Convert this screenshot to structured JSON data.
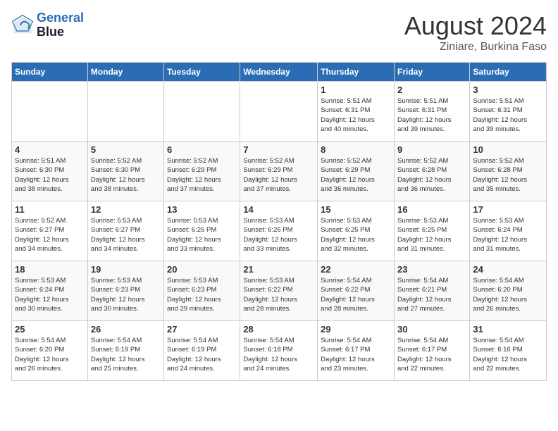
{
  "header": {
    "logo_line1": "General",
    "logo_line2": "Blue",
    "title": "August 2024",
    "subtitle": "Ziniare, Burkina Faso"
  },
  "weekdays": [
    "Sunday",
    "Monday",
    "Tuesday",
    "Wednesday",
    "Thursday",
    "Friday",
    "Saturday"
  ],
  "weeks": [
    [
      {
        "day": "",
        "info": ""
      },
      {
        "day": "",
        "info": ""
      },
      {
        "day": "",
        "info": ""
      },
      {
        "day": "",
        "info": ""
      },
      {
        "day": "1",
        "info": "Sunrise: 5:51 AM\nSunset: 6:31 PM\nDaylight: 12 hours\nand 40 minutes."
      },
      {
        "day": "2",
        "info": "Sunrise: 5:51 AM\nSunset: 6:31 PM\nDaylight: 12 hours\nand 39 minutes."
      },
      {
        "day": "3",
        "info": "Sunrise: 5:51 AM\nSunset: 6:31 PM\nDaylight: 12 hours\nand 39 minutes."
      }
    ],
    [
      {
        "day": "4",
        "info": "Sunrise: 5:51 AM\nSunset: 6:30 PM\nDaylight: 12 hours\nand 38 minutes."
      },
      {
        "day": "5",
        "info": "Sunrise: 5:52 AM\nSunset: 6:30 PM\nDaylight: 12 hours\nand 38 minutes."
      },
      {
        "day": "6",
        "info": "Sunrise: 5:52 AM\nSunset: 6:29 PM\nDaylight: 12 hours\nand 37 minutes."
      },
      {
        "day": "7",
        "info": "Sunrise: 5:52 AM\nSunset: 6:29 PM\nDaylight: 12 hours\nand 37 minutes."
      },
      {
        "day": "8",
        "info": "Sunrise: 5:52 AM\nSunset: 6:29 PM\nDaylight: 12 hours\nand 36 minutes."
      },
      {
        "day": "9",
        "info": "Sunrise: 5:52 AM\nSunset: 6:28 PM\nDaylight: 12 hours\nand 36 minutes."
      },
      {
        "day": "10",
        "info": "Sunrise: 5:52 AM\nSunset: 6:28 PM\nDaylight: 12 hours\nand 35 minutes."
      }
    ],
    [
      {
        "day": "11",
        "info": "Sunrise: 5:52 AM\nSunset: 6:27 PM\nDaylight: 12 hours\nand 34 minutes."
      },
      {
        "day": "12",
        "info": "Sunrise: 5:53 AM\nSunset: 6:27 PM\nDaylight: 12 hours\nand 34 minutes."
      },
      {
        "day": "13",
        "info": "Sunrise: 5:53 AM\nSunset: 6:26 PM\nDaylight: 12 hours\nand 33 minutes."
      },
      {
        "day": "14",
        "info": "Sunrise: 5:53 AM\nSunset: 6:26 PM\nDaylight: 12 hours\nand 33 minutes."
      },
      {
        "day": "15",
        "info": "Sunrise: 5:53 AM\nSunset: 6:25 PM\nDaylight: 12 hours\nand 32 minutes."
      },
      {
        "day": "16",
        "info": "Sunrise: 5:53 AM\nSunset: 6:25 PM\nDaylight: 12 hours\nand 31 minutes."
      },
      {
        "day": "17",
        "info": "Sunrise: 5:53 AM\nSunset: 6:24 PM\nDaylight: 12 hours\nand 31 minutes."
      }
    ],
    [
      {
        "day": "18",
        "info": "Sunrise: 5:53 AM\nSunset: 6:24 PM\nDaylight: 12 hours\nand 30 minutes."
      },
      {
        "day": "19",
        "info": "Sunrise: 5:53 AM\nSunset: 6:23 PM\nDaylight: 12 hours\nand 30 minutes."
      },
      {
        "day": "20",
        "info": "Sunrise: 5:53 AM\nSunset: 6:23 PM\nDaylight: 12 hours\nand 29 minutes."
      },
      {
        "day": "21",
        "info": "Sunrise: 5:53 AM\nSunset: 6:22 PM\nDaylight: 12 hours\nand 28 minutes."
      },
      {
        "day": "22",
        "info": "Sunrise: 5:54 AM\nSunset: 6:22 PM\nDaylight: 12 hours\nand 28 minutes."
      },
      {
        "day": "23",
        "info": "Sunrise: 5:54 AM\nSunset: 6:21 PM\nDaylight: 12 hours\nand 27 minutes."
      },
      {
        "day": "24",
        "info": "Sunrise: 5:54 AM\nSunset: 6:20 PM\nDaylight: 12 hours\nand 26 minutes."
      }
    ],
    [
      {
        "day": "25",
        "info": "Sunrise: 5:54 AM\nSunset: 6:20 PM\nDaylight: 12 hours\nand 26 minutes."
      },
      {
        "day": "26",
        "info": "Sunrise: 5:54 AM\nSunset: 6:19 PM\nDaylight: 12 hours\nand 25 minutes."
      },
      {
        "day": "27",
        "info": "Sunrise: 5:54 AM\nSunset: 6:19 PM\nDaylight: 12 hours\nand 24 minutes."
      },
      {
        "day": "28",
        "info": "Sunrise: 5:54 AM\nSunset: 6:18 PM\nDaylight: 12 hours\nand 24 minutes."
      },
      {
        "day": "29",
        "info": "Sunrise: 5:54 AM\nSunset: 6:17 PM\nDaylight: 12 hours\nand 23 minutes."
      },
      {
        "day": "30",
        "info": "Sunrise: 5:54 AM\nSunset: 6:17 PM\nDaylight: 12 hours\nand 22 minutes."
      },
      {
        "day": "31",
        "info": "Sunrise: 5:54 AM\nSunset: 6:16 PM\nDaylight: 12 hours\nand 22 minutes."
      }
    ]
  ]
}
